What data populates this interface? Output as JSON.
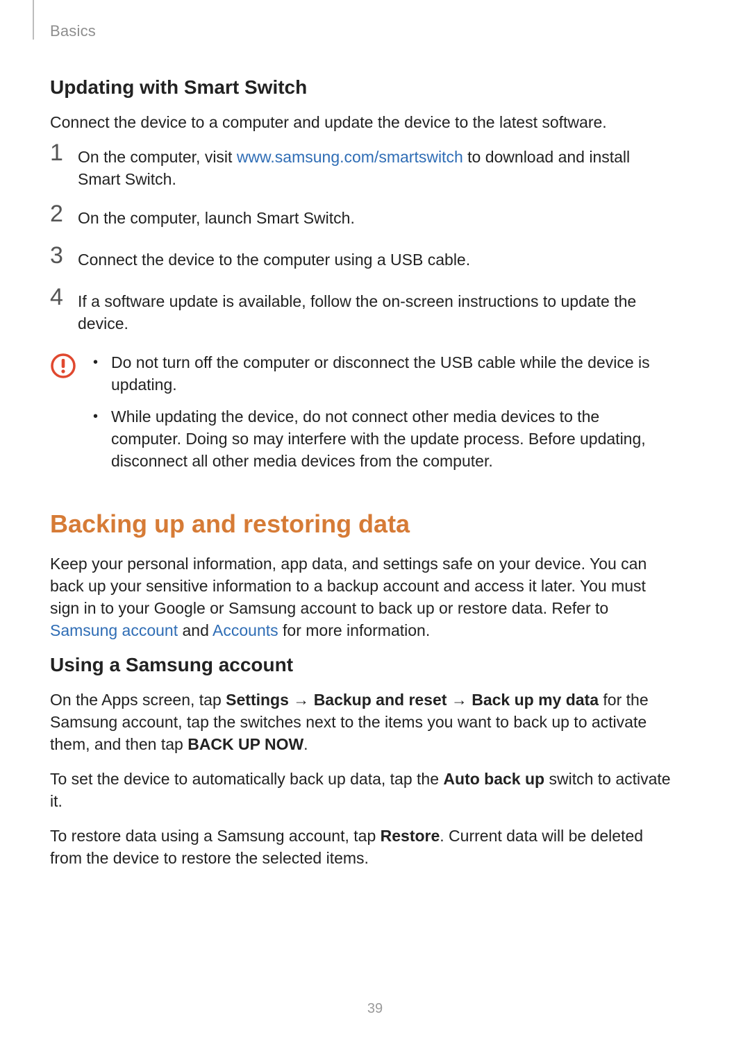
{
  "header": {
    "section": "Basics"
  },
  "h3_smartswitch": "Updating with Smart Switch",
  "p_smartswitch_intro": "Connect the device to a computer and update the device to the latest software.",
  "steps": {
    "s1_a": "On the computer, visit ",
    "s1_link": "www.samsung.com/smartswitch",
    "s1_b": " to download and install Smart Switch.",
    "s2": "On the computer, launch Smart Switch.",
    "s3": "Connect the device to the computer using a USB cable.",
    "s4": "If a software update is available, follow the on-screen instructions to update the device."
  },
  "caution": {
    "c1": "Do not turn off the computer or disconnect the USB cable while the device is updating.",
    "c2": "While updating the device, do not connect other media devices to the computer. Doing so may interfere with the update process. Before updating, disconnect all other media devices from the computer."
  },
  "h2_backup": "Backing up and restoring data",
  "p_backup_intro_a": "Keep your personal information, app data, and settings safe on your device. You can back up your sensitive information to a backup account and access it later. You must sign in to your Google or Samsung account to back up or restore data. Refer to ",
  "p_backup_link1": "Samsung account",
  "p_backup_intro_b": " and ",
  "p_backup_link2": "Accounts",
  "p_backup_intro_c": " for more information.",
  "h3_samsung": "Using a Samsung account",
  "p_sa_1a": "On the Apps screen, tap ",
  "p_sa_settings": "Settings",
  "arrow": " → ",
  "p_sa_backupreset": "Backup and reset",
  "p_sa_backupmydata": "Back up my data",
  "p_sa_1b": " for the Samsung account, tap the switches next to the items you want to back up to activate them, and then tap ",
  "p_sa_backupnow": "BACK UP NOW",
  "p_sa_1c": ".",
  "p_sa_2a": "To set the device to automatically back up data, tap the ",
  "p_sa_autobackup": "Auto back up",
  "p_sa_2b": " switch to activate it.",
  "p_sa_3a": "To restore data using a Samsung account, tap ",
  "p_sa_restore": "Restore",
  "p_sa_3b": ". Current data will be deleted from the device to restore the selected items.",
  "page_number": "39"
}
